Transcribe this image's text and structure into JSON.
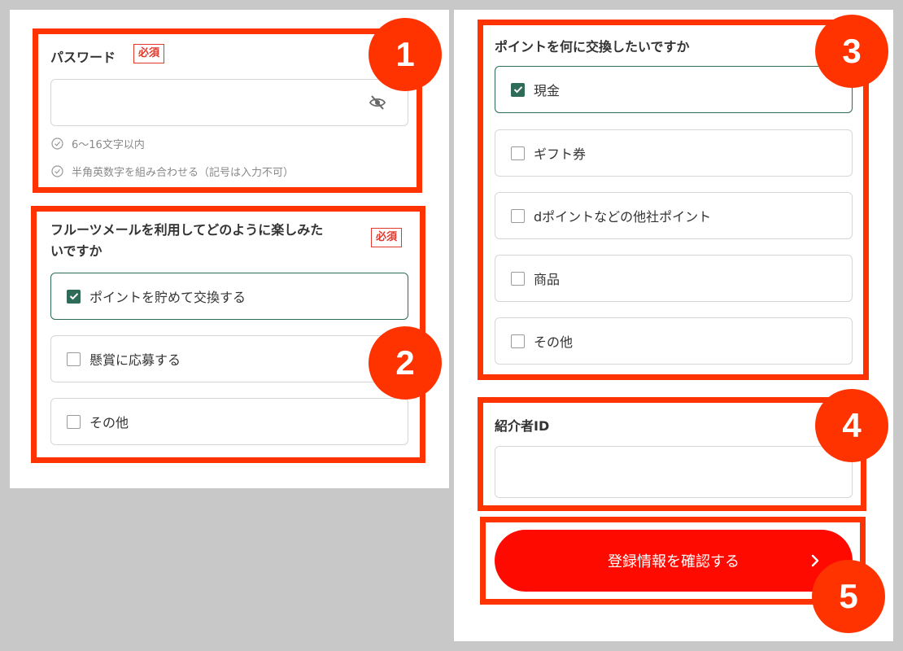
{
  "password": {
    "label": "パスワード",
    "required_label": "必須",
    "value": "",
    "icon": "eye-off-icon",
    "rules": [
      "6〜16文字以内",
      "半角英数字を組み合わせる（記号は入力不可）"
    ]
  },
  "usage": {
    "label_line1": "フルーツメールを利用してどのように楽しみた",
    "label_line2": "いですか",
    "required_label": "必須",
    "options": [
      {
        "label": "ポイントを貯めて交換する",
        "checked": true
      },
      {
        "label": "懸賞に応募する",
        "checked": false
      },
      {
        "label": "その他",
        "checked": false
      }
    ]
  },
  "exchange": {
    "label": "ポイントを何に交換したいですか",
    "options": [
      {
        "label": "現金",
        "checked": true
      },
      {
        "label": "ギフト券",
        "checked": false
      },
      {
        "label": "dポイントなどの他社ポイント",
        "checked": false
      },
      {
        "label": "商品",
        "checked": false
      },
      {
        "label": "その他",
        "checked": false
      }
    ]
  },
  "referrer": {
    "label": "紹介者ID",
    "value": ""
  },
  "submit": {
    "label": "登録情報を確認する",
    "icon": "chevron-right-icon"
  },
  "annotations": [
    "1",
    "2",
    "3",
    "4",
    "5"
  ],
  "colors": {
    "accent": "#ff3300",
    "button": "#ff0a00",
    "check": "#2e6b59",
    "required": "#e0382a"
  }
}
